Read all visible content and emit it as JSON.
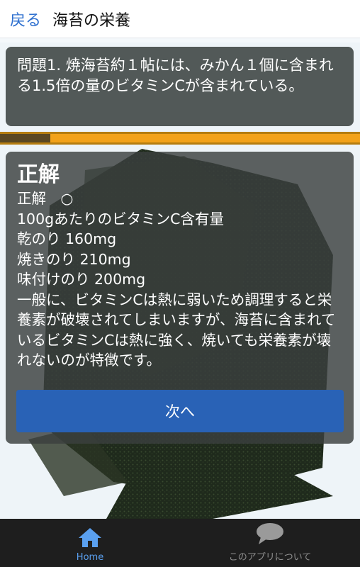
{
  "header": {
    "back_label": "戻る",
    "title": "海苔の栄養"
  },
  "question": {
    "text": "問題1. 焼海苔約１帖には、みかん１個に含まれる1.5倍の量のビタミンCが含まれている。"
  },
  "progress": {
    "fraction": 0.14
  },
  "answer": {
    "heading": "正解",
    "result_line": "正解　○",
    "lines": [
      "100gあたりのビタミンC含有量",
      "乾のり 160mg",
      "焼きのり 210mg",
      "味付けのり 200mg"
    ],
    "body": "一般に、ビタミンCは熱に弱いため調理すると栄養素が破壊されてしまいますが、海苔に含まれているビタミンCは熱に強く、焼いても栄養素が壊れないのが特徴です。",
    "next_label": "次へ"
  },
  "nav": {
    "home_label": "Home",
    "home_icon": "home-icon",
    "about_label": "このアプリについて",
    "about_icon": "speech-bubble-icon"
  },
  "colors": {
    "accent": "#2962b6",
    "back_link": "#2d6fcf",
    "progress_fill": "#f2a21a",
    "nav_active": "#5aa0f0"
  }
}
